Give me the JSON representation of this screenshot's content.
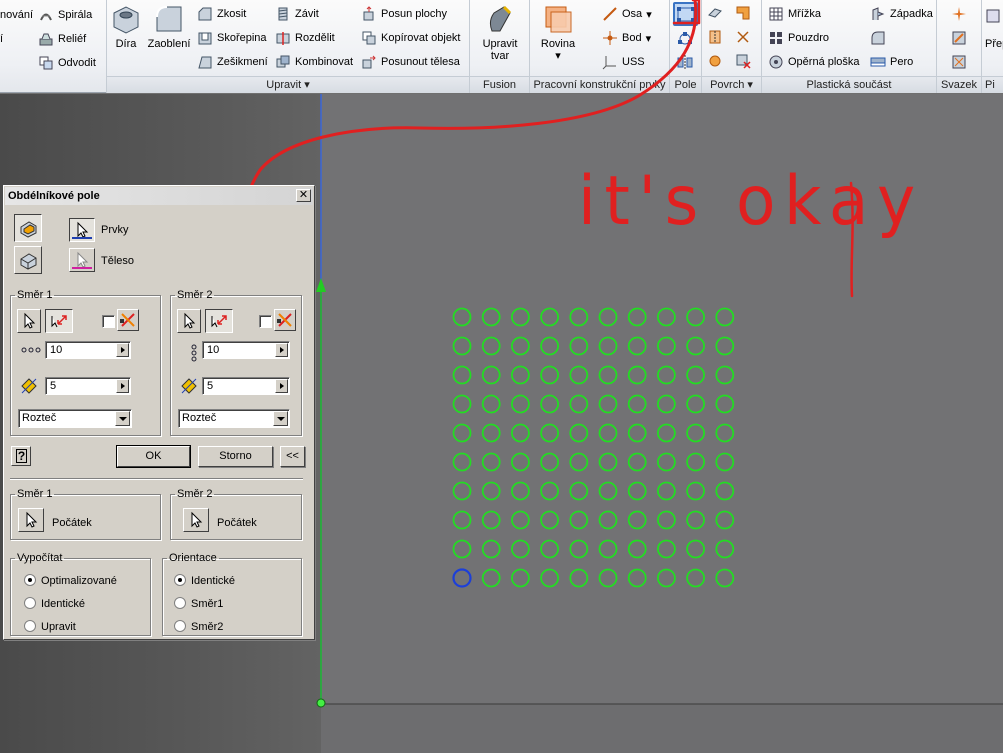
{
  "ribbon": {
    "cut_top_left_1": "nování",
    "cut_top_left_2": "í",
    "spirala": "Spirála",
    "relief": "Reliéf",
    "odvodit": "Odvodit",
    "dira": "Díra",
    "zaobleni": "Zaoblení",
    "zkosit": "Zkosit",
    "skorepina": "Skořepina",
    "zesikmeni": "Zešikmení",
    "zavit": "Závit",
    "rozdelit": "Rozdělit",
    "kombinovat": "Kombinovat",
    "posun_plochy": "Posun plochy",
    "kopirovat_objekt": "Kopírovat objekt",
    "posunout_telesa": "Posunout tělesa",
    "upravit_group": "Upravit",
    "upravit_tvar_1": "Upravit",
    "upravit_tvar_2": "tvar",
    "fusion_group": "Fusion",
    "rovina": "Rovina",
    "osa": "Osa",
    "bod": "Bod",
    "uss": "USS",
    "prac_group": "Pracovní konstrukční prvky",
    "pole_group": "Pole",
    "povrch_group": "Povrch",
    "mrizka": "Mřížka",
    "pouzdro": "Pouzdro",
    "operna_ploska": "Opěrná ploška",
    "zapadka": "Západka",
    "pero": "Pero",
    "plast_group": "Plastická součást",
    "svazek_group": "Svazek",
    "prep_cut": "Přep",
    "pi_cut": "Pi"
  },
  "dialog": {
    "title": "Obdélníkové pole",
    "close": "✕",
    "prvky": "Prvky",
    "teleso": "Těleso",
    "smer1_legend": "Směr 1",
    "smer2_legend": "Směr 2",
    "smer1_count": "10",
    "smer1_spacing": "5",
    "smer1_method": "Rozteč",
    "smer2_count": "10",
    "smer2_spacing": "5",
    "smer2_method": "Rozteč",
    "ok": "OK",
    "storno": "Storno",
    "more": "<<",
    "help": "?",
    "smer1_start_legend": "Směr 1",
    "smer2_start_legend": "Směr 2",
    "pocatek1": "Počátek",
    "pocatek2": "Počátek",
    "vypocitat_legend": "Vypočítat",
    "optimalizovane": "Optimalizované",
    "identicke_v": "Identické",
    "upravit": "Upravit",
    "orientace_legend": "Orientace",
    "identicke_o": "Identické",
    "smer1_o": "Směr1",
    "smer2_o": "Směr2",
    "vypocitat_selected": "Optimalizované",
    "orientace_selected": "Identické"
  },
  "annotation": {
    "text": "it's okay",
    "color": "#e02020"
  },
  "viewport": {
    "pattern_rows": 10,
    "pattern_cols": 10,
    "circle_color": "#22dd22",
    "seed_circle_color": "#1c3fd8",
    "axis_color": "#3a66d8"
  }
}
